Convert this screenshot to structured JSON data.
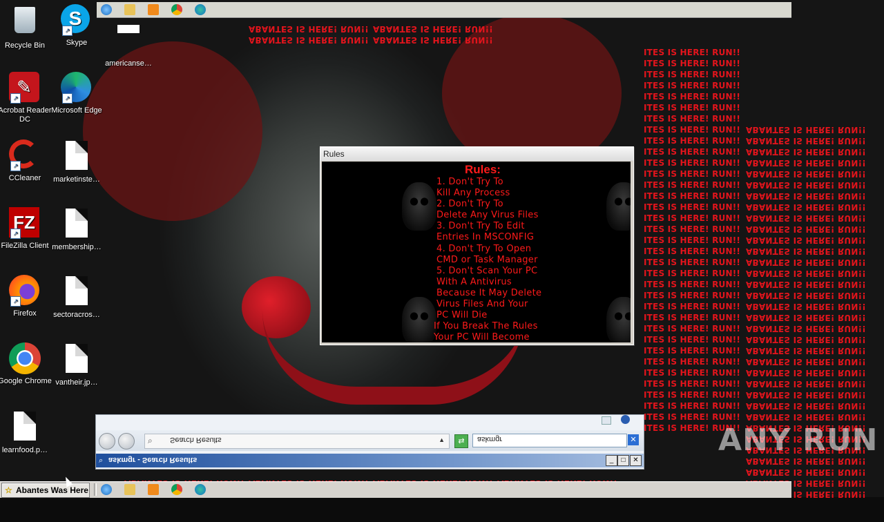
{
  "desktop": {
    "icons": [
      {
        "label": "Recycle Bin",
        "icon": "recycle-bin-icon"
      },
      {
        "label": "Skype",
        "icon": "skype-icon"
      },
      {
        "label": "americanse…",
        "icon": "file-icon"
      },
      {
        "label": "Acrobat Reader DC",
        "icon": "acrobat-icon"
      },
      {
        "label": "Microsoft Edge",
        "icon": "edge-icon"
      },
      {
        "label": "CCleaner",
        "icon": "ccleaner-icon"
      },
      {
        "label": "marketinste…",
        "icon": "file-icon"
      },
      {
        "label": "FileZilla Client",
        "icon": "filezilla-icon"
      },
      {
        "label": "membership…",
        "icon": "file-icon"
      },
      {
        "label": "Firefox",
        "icon": "firefox-icon"
      },
      {
        "label": "sectoracros…",
        "icon": "file-icon"
      },
      {
        "label": "Google Chrome",
        "icon": "chrome-icon"
      },
      {
        "label": "vantheir.jp…",
        "icon": "file-icon"
      },
      {
        "label": "learnfood.p…",
        "icon": "file-icon"
      }
    ]
  },
  "spam": {
    "line_a": "ITES IS HERE! RUN!!",
    "line_b": "ABANTES IS HERE! RUN!!",
    "line_c": "ABANTES IS HERE! RUN!!",
    "line_d": "RTES IS HERE! RUN!!"
  },
  "rules_window": {
    "title": "Rules",
    "heading": "Rules:",
    "body": "1. Don't Try To\nKill Any Process\n2. Don't Try To\nDelete Any Virus Files\n3. Don't Try To Edit\nEntries In MSCONFIG\n4. Don't Try To Open\nCMD or Task Manager\n5. Don't Scan Your PC\nWith A Antivirus\nBecause It May Delete\nVirus Files And Your\nPC Will Die",
    "footer": "If You Break The Rules\nYour PC Will Become"
  },
  "explorer_window": {
    "title": "askmgr - Search Results",
    "address": "Search Results",
    "search_value": "askmgr"
  },
  "taskbar": {
    "active_button_label": "Abantes Was Here"
  },
  "watermark": {
    "text": "ANY RUN"
  },
  "colors": {
    "spam_red": "#e3141c",
    "rules_red": "#ff1a1a"
  }
}
